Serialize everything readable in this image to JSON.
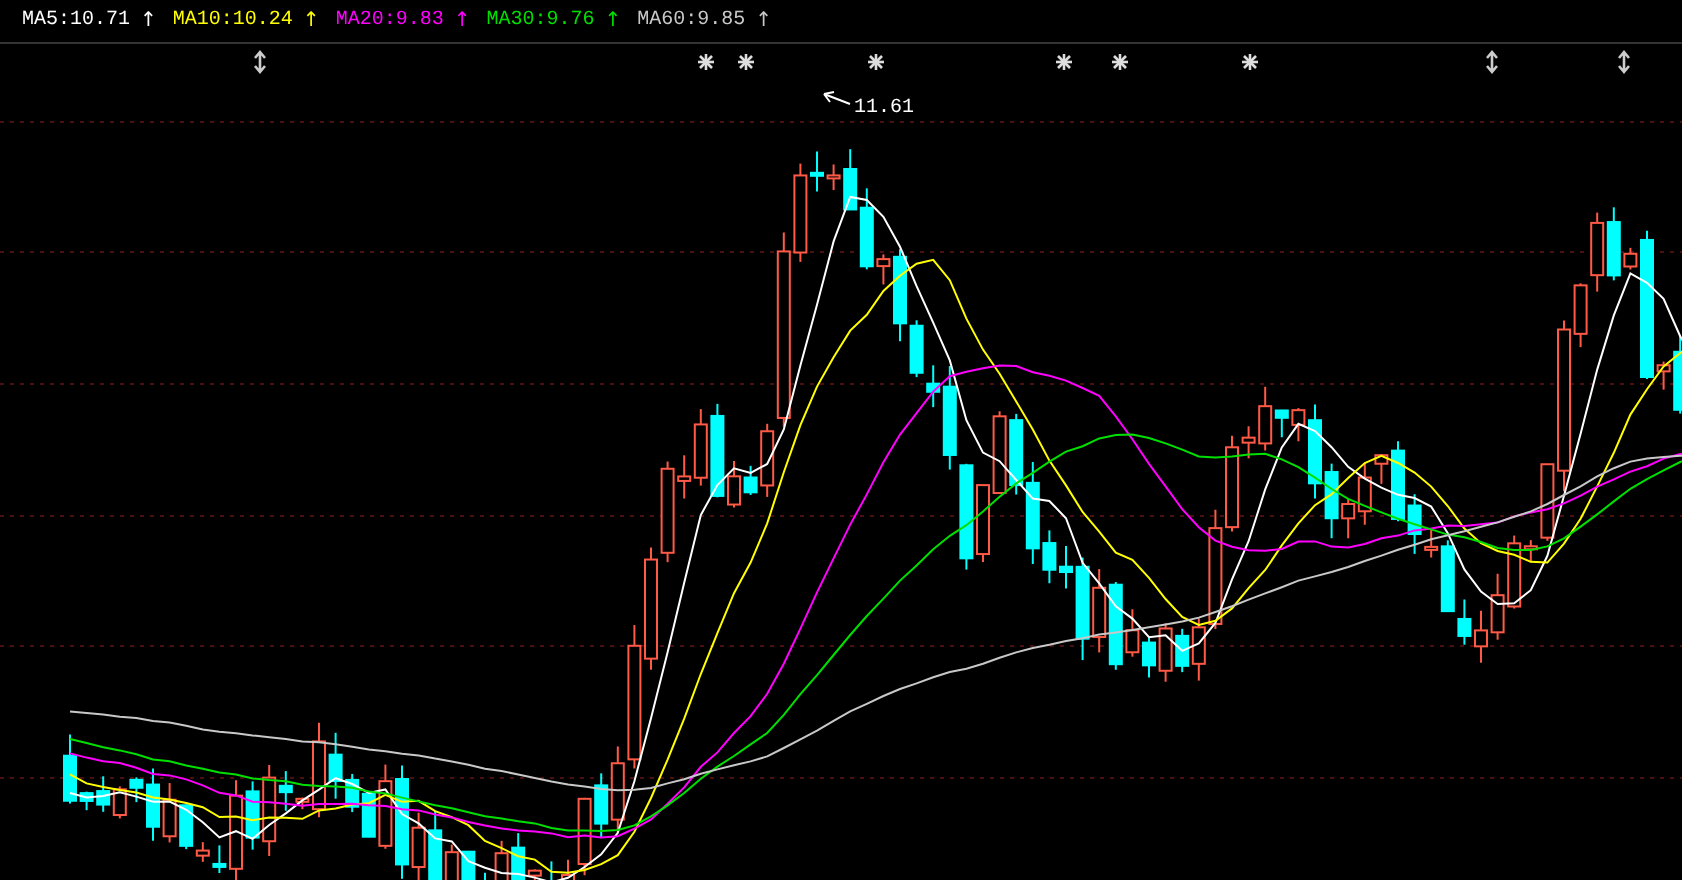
{
  "legend": [
    {
      "text": "MA5:10.71",
      "arrow": "↑",
      "color": "#ffffff"
    },
    {
      "text": "MA10:10.24",
      "arrow": "↑",
      "color": "#ffff00"
    },
    {
      "text": "MA20:9.83",
      "arrow": "↑",
      "color": "#ff00ff"
    },
    {
      "text": "MA30:9.76",
      "arrow": "↑",
      "color": "#00e000"
    },
    {
      "text": "MA60:9.85",
      "arrow": "↑",
      "color": "#c8c8c8"
    }
  ],
  "markers": [
    {
      "kind": "updown"
    },
    {
      "kind": "star"
    },
    {
      "kind": "star"
    },
    {
      "kind": "star"
    },
    {
      "kind": "star"
    },
    {
      "kind": "star"
    },
    {
      "kind": "star"
    },
    {
      "kind": "updown"
    },
    {
      "kind": "updown"
    }
  ],
  "high_label": "11.61"
}
